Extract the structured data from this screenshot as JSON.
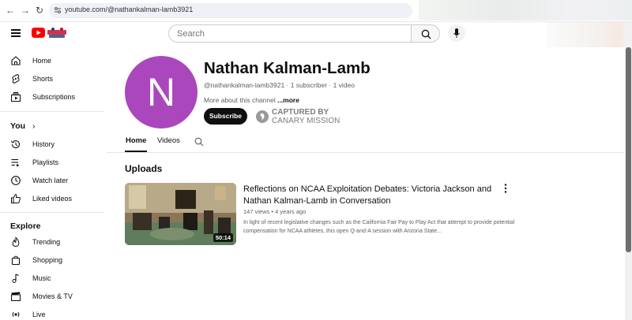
{
  "browser": {
    "url": "youtube.com/@nathankalman-lamb3921"
  },
  "header": {
    "search_placeholder": "Search"
  },
  "sidebar": {
    "items": [
      {
        "label": "Home",
        "icon": "home-icon"
      },
      {
        "label": "Shorts",
        "icon": "shorts-icon"
      },
      {
        "label": "Subscriptions",
        "icon": "subscriptions-icon"
      }
    ],
    "you_heading": "You",
    "you_items": [
      {
        "label": "History",
        "icon": "history-icon"
      },
      {
        "label": "Playlists",
        "icon": "playlists-icon"
      },
      {
        "label": "Watch later",
        "icon": "watch-later-icon"
      },
      {
        "label": "Liked videos",
        "icon": "liked-videos-icon"
      }
    ],
    "explore_heading": "Explore",
    "explore_items": [
      {
        "label": "Trending",
        "icon": "trending-icon"
      },
      {
        "label": "Shopping",
        "icon": "shopping-icon"
      },
      {
        "label": "Music",
        "icon": "music-icon"
      },
      {
        "label": "Movies & TV",
        "icon": "movies-icon"
      },
      {
        "label": "Live",
        "icon": "live-icon"
      }
    ]
  },
  "channel": {
    "avatar_letter": "N",
    "avatar_color": "#ab47bc",
    "name": "Nathan Kalman-Lamb",
    "meta": "@nathankalman-lamb3921 · 1 subscriber · 1 video",
    "desc": "More about this channel ",
    "desc_more": "...more",
    "subscribe_label": "Subscribe",
    "captured_line1": "CAPTURED BY",
    "captured_line2": "CANARY MISSION"
  },
  "tabs": [
    {
      "label": "Home",
      "active": true
    },
    {
      "label": "Videos",
      "active": false
    }
  ],
  "uploads": {
    "title": "Uploads",
    "video": {
      "title": "Reflections on NCAA Exploitation Debates: Victoria Jackson and Nathan Kalman-Lamb in Conversation",
      "meta": "147 views • 4 years ago",
      "description": "In light of recent legislative changes such as the California Fair Pay to Play Act that attempt to provide potential compensation for NCAA athletes, this open Q-and-A session with Arizona State...",
      "duration": "50:14"
    }
  }
}
